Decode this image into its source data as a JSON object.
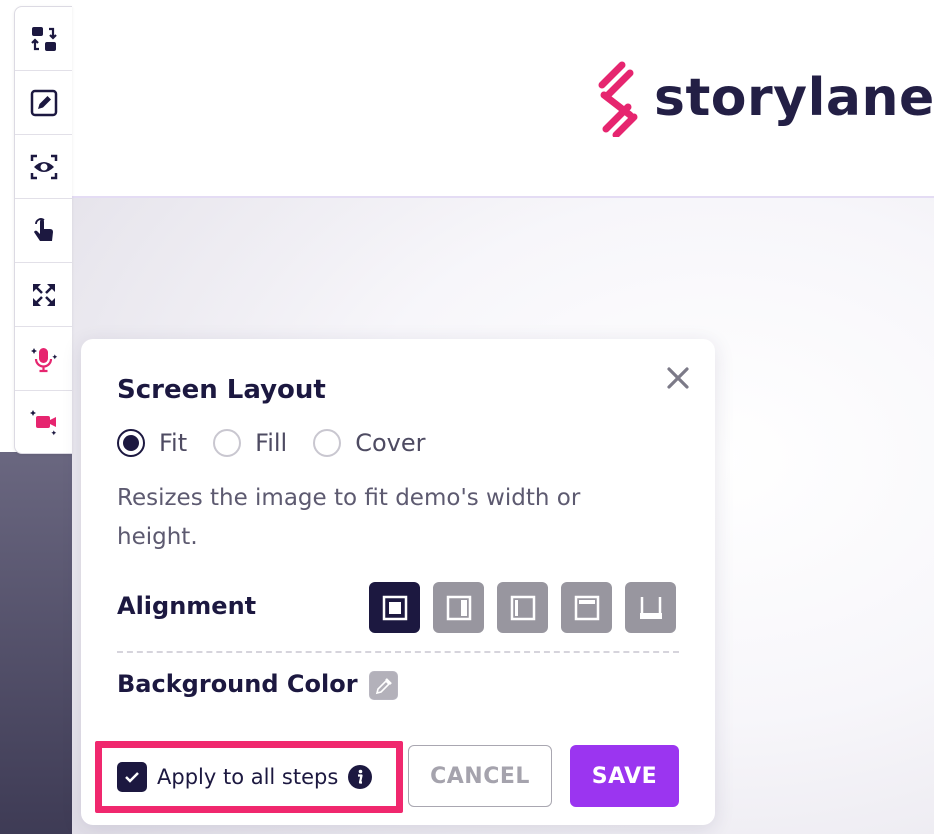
{
  "brand": {
    "name": "storylane",
    "accent_color": "#e6256f",
    "text_color": "#231f45"
  },
  "toolbar": {
    "items": [
      {
        "icon": "swap-screens-icon"
      },
      {
        "icon": "edit-icon"
      },
      {
        "icon": "preview-eye-icon"
      },
      {
        "icon": "hotspot-pointer-icon"
      },
      {
        "icon": "expand-icon"
      },
      {
        "icon": "ai-microphone-icon"
      },
      {
        "icon": "ai-video-icon"
      }
    ]
  },
  "dialog": {
    "title": "Screen Layout",
    "close_icon": "close-icon",
    "layout_options": [
      {
        "label": "Fit",
        "checked": true
      },
      {
        "label": "Fill",
        "checked": false
      },
      {
        "label": "Cover",
        "checked": false
      }
    ],
    "description": "Resizes the image to fit demo's width or height.",
    "alignment_label": "Alignment",
    "alignment_options": [
      {
        "icon": "align-center-icon",
        "active": true
      },
      {
        "icon": "align-right-icon",
        "active": false
      },
      {
        "icon": "align-left-icon",
        "active": false
      },
      {
        "icon": "align-top-icon",
        "active": false
      },
      {
        "icon": "align-bottom-icon",
        "active": false
      }
    ],
    "background_color_label": "Background Color",
    "background_color_icon": "eyedropper-icon",
    "apply_all": {
      "label": "Apply to all steps",
      "checked": true,
      "info_icon": "info-icon"
    },
    "cancel_label": "CANCEL",
    "save_label": "SAVE",
    "highlight_color": "#f0286e",
    "save_color": "#9b35f0"
  }
}
